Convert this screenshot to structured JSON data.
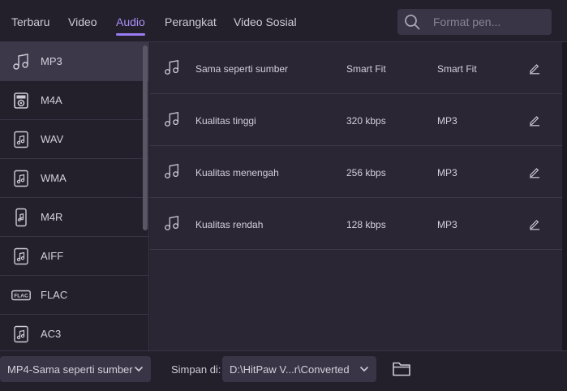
{
  "tabs": [
    "Terbaru",
    "Video",
    "Audio",
    "Perangkat",
    "Video Sosial"
  ],
  "active_tab": "Audio",
  "search": {
    "placeholder": "Format pen..."
  },
  "formats": [
    {
      "label": "MP3",
      "icon": "music-note-icon",
      "selected": true
    },
    {
      "label": "M4A",
      "icon": "speaker-icon",
      "selected": false
    },
    {
      "label": "WAV",
      "icon": "music-file-icon",
      "selected": false
    },
    {
      "label": "WMA",
      "icon": "music-file-icon",
      "selected": false
    },
    {
      "label": "M4R",
      "icon": "phone-music-icon",
      "selected": false
    },
    {
      "label": "AIFF",
      "icon": "music-file-icon",
      "selected": false
    },
    {
      "label": "FLAC",
      "icon": "flac-badge-icon",
      "selected": false
    },
    {
      "label": "AC3",
      "icon": "music-file-icon",
      "selected": false
    }
  ],
  "presets": [
    {
      "name": "Sama seperti sumber",
      "quality": "Smart Fit",
      "format": "Smart Fit"
    },
    {
      "name": "Kualitas tinggi",
      "quality": "320 kbps",
      "format": "MP3"
    },
    {
      "name": "Kualitas menengah",
      "quality": "256 kbps",
      "format": "MP3"
    },
    {
      "name": "Kualitas rendah",
      "quality": "128 kbps",
      "format": "MP3"
    }
  ],
  "bottom": {
    "output_format": "MP4-Sama seperti sumber",
    "save_label": "Simpan di:",
    "save_path": "D:\\HitPaw V...r\\Converted"
  },
  "colors": {
    "accent": "#9a7cf2",
    "background": "#231f2b",
    "panel": "#2a2633"
  }
}
